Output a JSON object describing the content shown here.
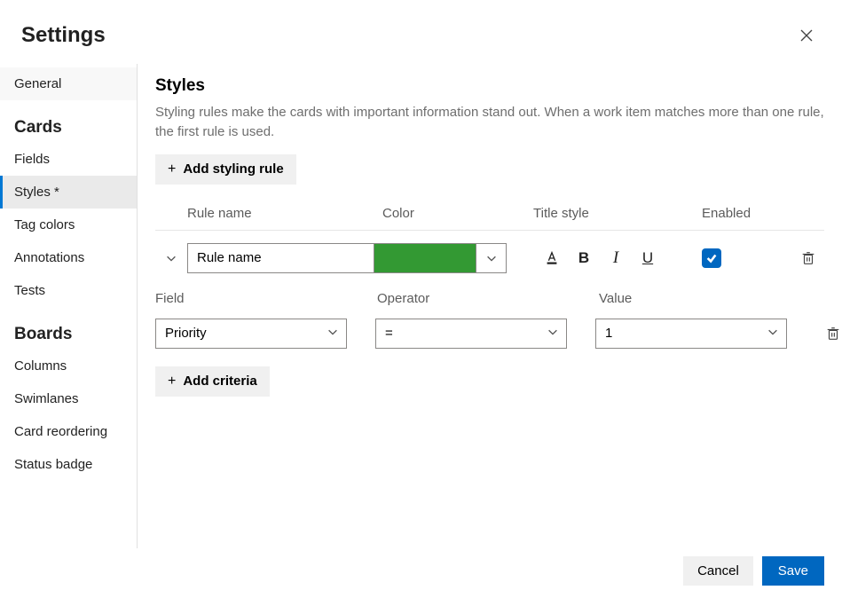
{
  "dialog": {
    "title": "Settings"
  },
  "sidebar": {
    "general": "General",
    "groups": [
      {
        "title": "Cards",
        "items": [
          {
            "label": "Fields"
          },
          {
            "label": "Styles *",
            "active": true
          },
          {
            "label": "Tag colors"
          },
          {
            "label": "Annotations"
          },
          {
            "label": "Tests"
          }
        ]
      },
      {
        "title": "Boards",
        "items": [
          {
            "label": "Columns"
          },
          {
            "label": "Swimlanes"
          },
          {
            "label": "Card reordering"
          },
          {
            "label": "Status badge"
          }
        ]
      }
    ]
  },
  "page": {
    "heading": "Styles",
    "description": "Styling rules make the cards with important information stand out. When a work item matches more than one rule, the first rule is used.",
    "add_rule_label": "Add styling rule",
    "cols": {
      "name": "Rule name",
      "color": "Color",
      "titleStyle": "Title style",
      "enabled": "Enabled"
    },
    "rule": {
      "name": "Rule name",
      "color": "#339933",
      "enabled": true
    },
    "criteria_cols": {
      "field": "Field",
      "operator": "Operator",
      "value": "Value"
    },
    "criteria": {
      "field": "Priority",
      "operator": "=",
      "value": "1"
    },
    "add_criteria_label": "Add criteria"
  },
  "footer": {
    "cancel": "Cancel",
    "save": "Save"
  }
}
